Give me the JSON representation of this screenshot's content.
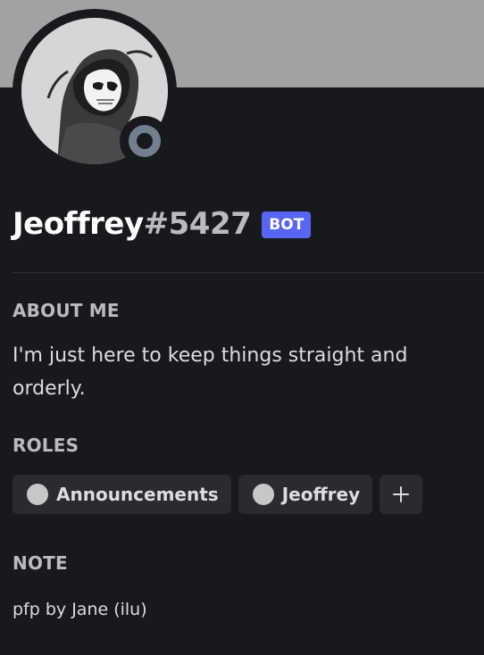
{
  "profile": {
    "username": "Jeoffrey",
    "discriminator": "#5427",
    "bot_tag": "BOT",
    "status": "offline",
    "banner_color": "#a2a2a2"
  },
  "about": {
    "title": "ABOUT ME",
    "text": "I'm just here to keep things straight and orderly."
  },
  "roles": {
    "title": "ROLES",
    "items": [
      {
        "label": "Announcements",
        "color": "#c7c7c7"
      },
      {
        "label": "Jeoffrey",
        "color": "#c7c7c7"
      }
    ],
    "add_icon": "plus-icon"
  },
  "note": {
    "title": "NOTE",
    "text": "pfp by Jane (ilu)"
  },
  "colors": {
    "background": "#18191c",
    "bot_badge": "#5865f2",
    "status_offline": "#747f8d",
    "pill": "#292b2f"
  }
}
